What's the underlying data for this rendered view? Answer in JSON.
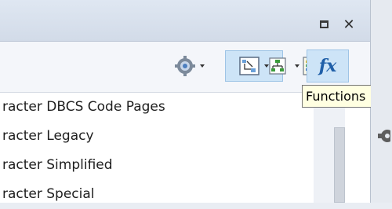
{
  "window": {
    "restore_icon": "restore-icon",
    "close_icon": "close-icon",
    "close_glyph": "✕"
  },
  "toolbar": {
    "buttons": [
      {
        "name": "settings-gear",
        "icon": "gear-icon",
        "has_dropdown": true
      },
      {
        "name": "diagram-view",
        "icon": "diagram-icon",
        "has_dropdown": true,
        "selected": true
      },
      {
        "name": "list-view",
        "icon": "list-icon",
        "has_dropdown": true
      },
      {
        "name": "hierarchy-view",
        "icon": "hierarchy-icon",
        "has_dropdown": true
      },
      {
        "name": "functions",
        "icon": "fx-icon",
        "has_dropdown": false,
        "selected": true,
        "glyph": "fx"
      }
    ]
  },
  "tooltip": {
    "text": "Functions"
  },
  "list": {
    "items": [
      "racter DBCS Code Pages",
      "racter Legacy",
      "racter Simplified",
      "racter Special"
    ]
  },
  "colors": {
    "selection": "#cde4f7",
    "tooltip_bg": "#ffffe1",
    "accent_blue": "#1f5fa8"
  }
}
